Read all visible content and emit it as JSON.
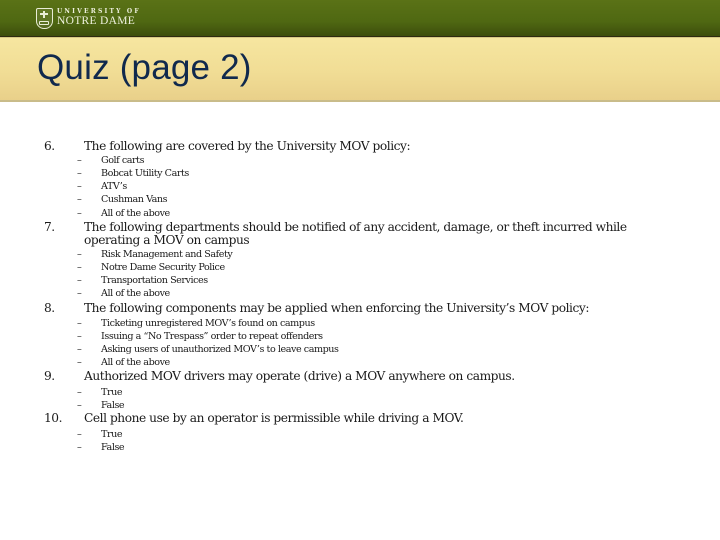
{
  "header": {
    "logo": {
      "icon": "university-shield-icon",
      "line1": "UNIVERSITY OF",
      "line2": "NOTRE DAME"
    },
    "colors": {
      "header_green": "#4f6812",
      "title_band": "#f1dd95",
      "title_text": "#10294d"
    }
  },
  "slide": {
    "title": "Quiz (page 2)"
  },
  "questions": [
    {
      "number": "6.",
      "text": "The following are covered by the University MOV policy:",
      "options": [
        "Golf carts",
        "Bobcat Utility Carts",
        "ATV’s",
        "Cushman Vans",
        "All of the above"
      ]
    },
    {
      "number": "7.",
      "text": "The following departments should be notified of any accident, damage, or theft incurred while operating a MOV on campus",
      "options": [
        "Risk Management and Safety",
        "Notre Dame Security Police",
        "Transportation Services",
        "All of the above"
      ]
    },
    {
      "number": "8.",
      "text": "The following components may be applied when enforcing the University’s MOV policy:",
      "options": [
        "Ticketing unregistered MOV’s found on campus",
        "Issuing a “No Trespass” order to repeat offenders",
        "Asking users of unauthorized MOV’s to leave campus",
        "All of the above"
      ]
    },
    {
      "number": "9.",
      "text": "Authorized MOV drivers may operate (drive) a MOV anywhere on campus.",
      "options": [
        "True",
        "False"
      ]
    },
    {
      "number": "10.",
      "text": "Cell phone use by an operator is permissible while driving a MOV.",
      "options": [
        "True",
        "False"
      ]
    }
  ],
  "bullet_glyph": "–"
}
